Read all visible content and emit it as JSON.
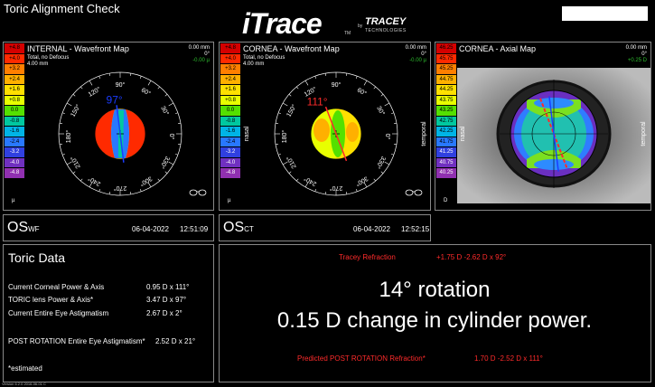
{
  "window_title": "Toric Alignment Check",
  "logo": {
    "brand": "iTrace",
    "tm": "TM",
    "by": "by",
    "company": "TRACEY",
    "company_sub": "TECHNOLOGIES"
  },
  "panels": [
    {
      "title": "INTERNAL - Wavefront Map",
      "info1": "Total, no Defocus",
      "info2": "4.00 mm",
      "right1": "0.00 mm",
      "right2": "0°",
      "right3": "-0.00 µ",
      "scale": [
        "+4.8",
        "+4.0",
        "+3.2",
        "+2.4",
        "+1.6",
        "+0.8",
        "0.0",
        "-0.8",
        "-1.6",
        "-2.4",
        "-3.2",
        "-4.0",
        "-4.8"
      ],
      "unit": "µ",
      "axis_label": "97°",
      "axis_deg": 97
    },
    {
      "title": "CORNEA - Wavefront Map",
      "info1": "Total, no Defocus",
      "info2": "4.00 mm",
      "right1": "0.00 mm",
      "right2": "0°",
      "right3": "-0.00 µ",
      "scale": [
        "+4.8",
        "+4.0",
        "+3.2",
        "+2.4",
        "+1.6",
        "+0.8",
        "0.0",
        "-0.8",
        "-1.6",
        "-2.4",
        "-3.2",
        "-4.0",
        "-4.8"
      ],
      "unit": "µ",
      "axis_label": "111°",
      "axis_deg": 111,
      "nasal": "nasal",
      "temporal": "temporal"
    },
    {
      "title": "CORNEA - Axial Map",
      "right1": "0.00 mm",
      "right2": "0°",
      "right3": "+0.25 D",
      "scale": [
        "46.25",
        "45.75",
        "45.25",
        "44.75",
        "44.25",
        "43.75",
        "43.25",
        "42.75",
        "42.25",
        "41.75",
        "41.25",
        "40.75",
        "40.25"
      ],
      "unit": "D",
      "nasal": "nasal",
      "temporal": "temporal"
    }
  ],
  "degree_labels": [
    "0°",
    "30°",
    "60°",
    "90°",
    "120°",
    "150°",
    "180°",
    "210°",
    "240°",
    "270°",
    "300°",
    "330°"
  ],
  "os_rows": [
    {
      "eye": "OS",
      "sub": "WF",
      "date": "06-04-2022",
      "time": "12:51:09"
    },
    {
      "eye": "OS",
      "sub": "CT",
      "date": "06-04-2022",
      "time": "12:52:15"
    }
  ],
  "toric": {
    "title": "Toric Data",
    "rows": [
      {
        "label": "Current Corneal Power & Axis",
        "value": "0.95 D x 111°"
      },
      {
        "label": "TORIC lens Power & Axis*",
        "value": "3.47 D x 97°"
      },
      {
        "label": "Current Entire Eye Astigmatism",
        "value": "2.67 D x 2°"
      },
      {
        "label": "POST ROTATION Entire Eye Astigmatism*",
        "value": "2.52 D x 21°"
      }
    ],
    "footnote": "*estimated"
  },
  "result": {
    "tracey_label": "Tracey Refraction",
    "tracey_value": "+1.75 D -2.62 D x 92°",
    "headline": "14° rotation",
    "subline": "0.15 D change in cylinder power.",
    "predicted_label": "Predicted POST ROTATION Refraction*",
    "predicted_value": "1.70 D  -2.52 D x 111°"
  },
  "version": "Version 6.2.0 2016-06-01 C",
  "colors": {
    "scale_wf": [
      "#d40000",
      "#ff2a00",
      "#ff7f00",
      "#ffb000",
      "#ffe000",
      "#e8ff00",
      "#54e000",
      "#00c8a0",
      "#00b4e6",
      "#2878ff",
      "#3040e0",
      "#7030c0",
      "#9030b0"
    ],
    "scale_axial": [
      "#d40000",
      "#ff2a00",
      "#ff7f00",
      "#ffb000",
      "#ffe000",
      "#e8ff00",
      "#54e000",
      "#00c8a0",
      "#00b4e6",
      "#2878ff",
      "#3040e0",
      "#7030c0",
      "#9030b0"
    ],
    "accent_red": "#ff2b2b",
    "axis_blue": "#1a3cff"
  }
}
